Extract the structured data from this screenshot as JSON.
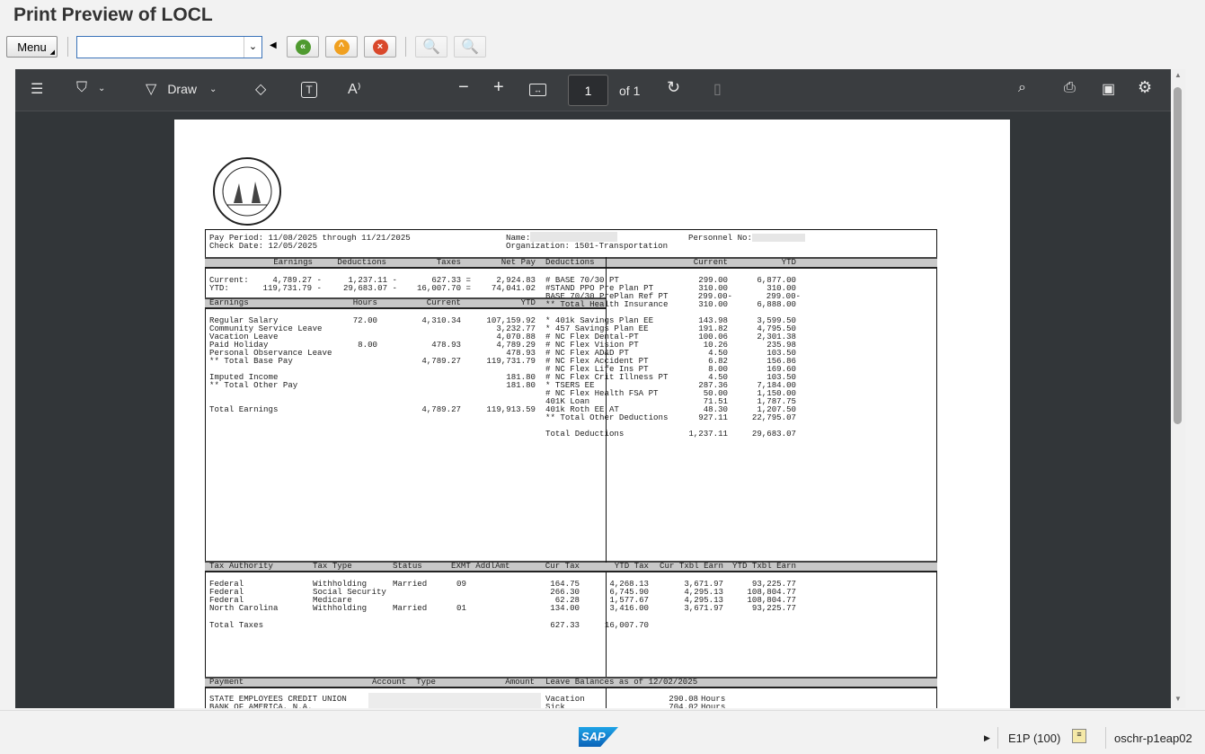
{
  "window": {
    "title": "Print Preview of LOCL"
  },
  "toolbar": {
    "menu_label": "Menu",
    "command_value": ""
  },
  "viewer": {
    "draw_label": "Draw",
    "page_number": "1",
    "page_of": "of 1"
  },
  "doc": {
    "header": {
      "pay_period": "Pay Period: 11/08/2025 through 11/21/2025",
      "check_date": "Check Date: 12/05/2025",
      "name_label": "Name:",
      "organization": "Organization: 1501-Transportation",
      "personnel_label": "Personnel No:"
    },
    "summary_headers": [
      "Earnings",
      "Deductions",
      "Taxes",
      "Net Pay"
    ],
    "summary_rows": [
      [
        "Current:",
        "4,789.27 -",
        "1,237.11 -",
        "627.33 =",
        "2,924.83"
      ],
      [
        "YTD:",
        "119,731.79 -",
        "29,683.07 -",
        "16,007.70 =",
        "74,041.02"
      ]
    ],
    "earnings_headers": [
      "Earnings",
      "Hours",
      "Current",
      "YTD"
    ],
    "earnings_rows": [
      [
        "Regular Salary",
        "72.00",
        "4,310.34",
        "107,159.92"
      ],
      [
        "Community Service Leave",
        "",
        "",
        "3,232.77"
      ],
      [
        "Vacation Leave",
        "",
        "",
        "4,070.88"
      ],
      [
        "Paid Holiday",
        "8.00",
        "478.93",
        "4,789.29"
      ],
      [
        "Personal Observance Leave",
        "",
        "",
        "478.93"
      ],
      [
        "** Total Base Pay",
        "",
        "4,789.27",
        "119,731.79"
      ],
      [
        "",
        "",
        "",
        ""
      ],
      [
        "Imputed Income",
        "",
        "",
        "181.80"
      ],
      [
        "** Total Other Pay",
        "",
        "",
        "181.80"
      ],
      [
        "",
        "",
        "",
        ""
      ],
      [
        "",
        "",
        "",
        ""
      ],
      [
        "Total Earnings",
        "",
        "4,789.27",
        "119,913.59"
      ]
    ],
    "deduction_headers": [
      "Deductions",
      "Current",
      "YTD"
    ],
    "deduction_rows_health": [
      [
        "# BASE 70/30 PT",
        "299.00",
        "6,877.00"
      ],
      [
        "#STAND PPO Pre Plan PT",
        "310.00",
        "310.00"
      ],
      [
        "BASE 70/30 PrePlan Ref PT",
        "299.00-",
        "299.00-"
      ],
      [
        "** Total Health Insurance",
        "310.00",
        "6,888.00"
      ]
    ],
    "deduction_rows_other": [
      [
        "* 401k Savings Plan EE",
        "143.98",
        "3,599.50"
      ],
      [
        "* 457 Savings Plan EE",
        "191.82",
        "4,795.50"
      ],
      [
        "# NC Flex Dental-PT",
        "100.06",
        "2,301.38"
      ],
      [
        "# NC Flex Vision PT",
        "10.26",
        "235.98"
      ],
      [
        "# NC Flex AD&D PT",
        "4.50",
        "103.50"
      ],
      [
        "# NC Flex Accident PT",
        "6.82",
        "156.86"
      ],
      [
        "# NC Flex Life Ins PT",
        "8.00",
        "169.60"
      ],
      [
        "# NC Flex Crit Illness PT",
        "4.50",
        "103.50"
      ],
      [
        "* TSERS EE",
        "287.36",
        "7,184.00"
      ],
      [
        "# NC Flex Health FSA PT",
        "50.00",
        "1,150.00"
      ],
      [
        "401K Loan",
        "71.51",
        "1,787.75"
      ],
      [
        "401k Roth EE AT",
        "48.30",
        "1,207.50"
      ],
      [
        "** Total Other Deductions",
        "927.11",
        "22,795.07"
      ],
      [
        "",
        "",
        ""
      ],
      [
        "Total Deductions",
        "1,237.11",
        "29,683.07"
      ]
    ],
    "tax_headers": [
      "Tax Authority",
      "Tax Type",
      "Status",
      "EXMT AddlAmt",
      "Cur Tax",
      "YTD Tax",
      "Cur Txbl Earn",
      "YTD Txbl Earn"
    ],
    "tax_rows": [
      [
        "Federal",
        "Withholding",
        "Married",
        "09",
        "164.75",
        "4,268.13",
        "3,671.97",
        "93,225.77"
      ],
      [
        "Federal",
        "Social Security",
        "",
        "",
        "266.30",
        "6,745.90",
        "4,295.13",
        "108,804.77"
      ],
      [
        "Federal",
        "Medicare",
        "",
        "",
        "62.28",
        "1,577.67",
        "4,295.13",
        "108,804.77"
      ],
      [
        "North Carolina",
        "Withholding",
        "Married",
        "01",
        "134.00",
        "3,416.00",
        "3,671.97",
        "93,225.77"
      ],
      [
        "",
        "",
        "",
        "",
        "",
        "",
        "",
        ""
      ],
      [
        "Total Taxes",
        "",
        "",
        "",
        "627.33",
        "16,007.70",
        "",
        ""
      ]
    ],
    "payment_headers": [
      "Payment",
      "Account  Type",
      "Amount",
      "Leave Balances as of 12/02/2025"
    ],
    "payment_rows": [
      [
        "STATE EMPLOYEES CREDIT UNION"
      ],
      [
        "BANK OF AMERICA, N.A."
      ]
    ],
    "leave_rows": [
      [
        "Vacation",
        "290.08",
        "Hours"
      ],
      [
        "Sick",
        "704.02",
        "Hours"
      ]
    ]
  },
  "status": {
    "logo": "SAP",
    "system": "E1P (100)",
    "server": "oschr-p1eap02"
  }
}
